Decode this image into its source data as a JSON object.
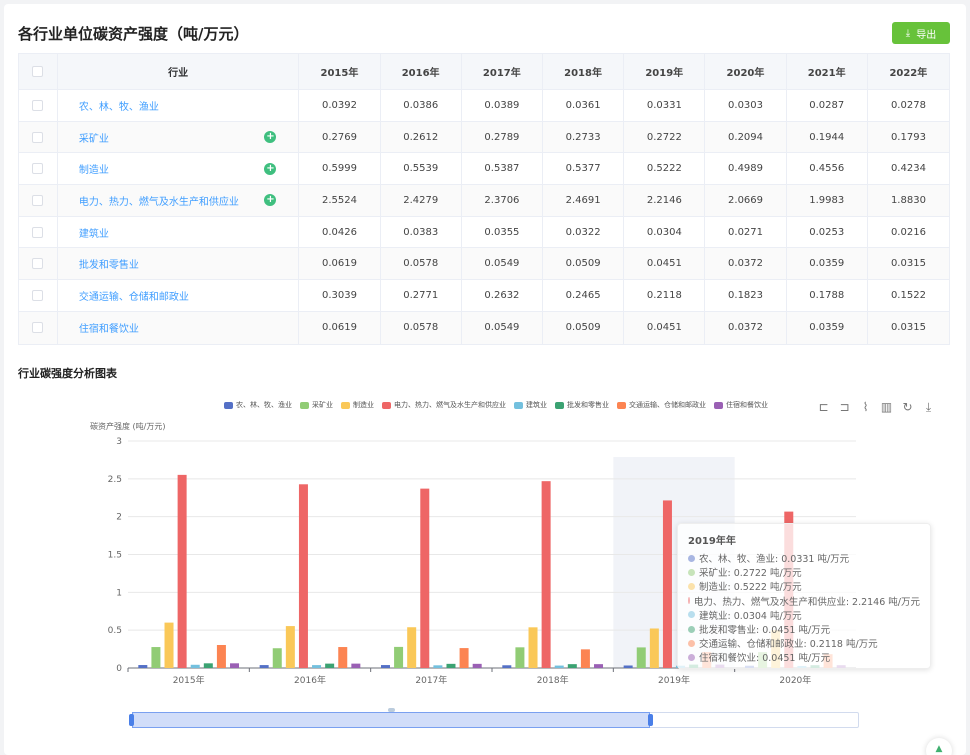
{
  "page": {
    "title": "各行业单位碳资产强度（吨/万元）",
    "export_label": "导出",
    "chart_section_title": "行业碳强度分析图表",
    "scroll_top_icon": "arrow-up-icon"
  },
  "table": {
    "header": {
      "name": "行业",
      "years": [
        "2015年",
        "2016年",
        "2017年",
        "2018年",
        "2019年",
        "2020年",
        "2021年",
        "2022年"
      ]
    },
    "rows": [
      {
        "name": "农、林、牧、渔业",
        "expandable": false,
        "values": [
          "0.0392",
          "0.0386",
          "0.0389",
          "0.0361",
          "0.0331",
          "0.0303",
          "0.0287",
          "0.0278"
        ]
      },
      {
        "name": "采矿业",
        "expandable": true,
        "values": [
          "0.2769",
          "0.2612",
          "0.2789",
          "0.2733",
          "0.2722",
          "0.2094",
          "0.1944",
          "0.1793"
        ]
      },
      {
        "name": "制造业",
        "expandable": true,
        "values": [
          "0.5999",
          "0.5539",
          "0.5387",
          "0.5377",
          "0.5222",
          "0.4989",
          "0.4556",
          "0.4234"
        ]
      },
      {
        "name": "电力、热力、燃气及水生产和供应业",
        "expandable": true,
        "values": [
          "2.5524",
          "2.4279",
          "2.3706",
          "2.4691",
          "2.2146",
          "2.0669",
          "1.9983",
          "1.8830"
        ]
      },
      {
        "name": "建筑业",
        "expandable": false,
        "values": [
          "0.0426",
          "0.0383",
          "0.0355",
          "0.0322",
          "0.0304",
          "0.0271",
          "0.0253",
          "0.0216"
        ]
      },
      {
        "name": "批发和零售业",
        "expandable": false,
        "values": [
          "0.0619",
          "0.0578",
          "0.0549",
          "0.0509",
          "0.0451",
          "0.0372",
          "0.0359",
          "0.0315"
        ]
      },
      {
        "name": "交通运输、仓储和邮政业",
        "expandable": false,
        "values": [
          "0.3039",
          "0.2771",
          "0.2632",
          "0.2465",
          "0.2118",
          "0.1823",
          "0.1788",
          "0.1522"
        ]
      },
      {
        "name": "住宿和餐饮业",
        "expandable": false,
        "values": [
          "0.0619",
          "0.0578",
          "0.0549",
          "0.0509",
          "0.0451",
          "0.0372",
          "0.0359",
          "0.0315"
        ]
      }
    ]
  },
  "toolbox": [
    "crop-zoom-icon",
    "zoom-reset-icon",
    "line-chart-icon",
    "bar-chart-icon",
    "restore-icon",
    "download-icon"
  ],
  "chart_data": {
    "type": "bar",
    "ylabel": "碳资产强度 (吨/万元)",
    "ylim": [
      0,
      3
    ],
    "yticks": [
      "0",
      "0.5",
      "1",
      "1.5",
      "2",
      "2.5",
      "3"
    ],
    "categories": [
      "2015年",
      "2016年",
      "2017年",
      "2018年",
      "2019年",
      "2020年"
    ],
    "grid": true,
    "legend_position": "top",
    "highlighted_category": "2019年",
    "series": [
      {
        "name": "农、林、牧、渔业",
        "color": "#5470c6",
        "values": [
          0.0392,
          0.0386,
          0.0389,
          0.0361,
          0.0331,
          0.0303
        ]
      },
      {
        "name": "采矿业",
        "color": "#91cc75",
        "values": [
          0.2769,
          0.2612,
          0.2789,
          0.2733,
          0.2722,
          0.2094
        ]
      },
      {
        "name": "制造业",
        "color": "#fac858",
        "values": [
          0.5999,
          0.5539,
          0.5387,
          0.5377,
          0.5222,
          0.4989
        ]
      },
      {
        "name": "电力、热力、燃气及水生产和供应业",
        "color": "#ee6666",
        "values": [
          2.5524,
          2.4279,
          2.3706,
          2.4691,
          2.2146,
          2.0669
        ]
      },
      {
        "name": "建筑业",
        "color": "#73c0de",
        "values": [
          0.0426,
          0.0383,
          0.0355,
          0.0322,
          0.0304,
          0.0271
        ]
      },
      {
        "name": "批发和零售业",
        "color": "#3ba272",
        "values": [
          0.0619,
          0.0578,
          0.0549,
          0.0509,
          0.0451,
          0.0372
        ]
      },
      {
        "name": "交通运输、仓储和邮政业",
        "color": "#fc8452",
        "values": [
          0.3039,
          0.2771,
          0.2632,
          0.2465,
          0.2118,
          0.1823
        ]
      },
      {
        "name": "住宿和餐饮业",
        "color": "#9a60b4",
        "values": [
          0.0619,
          0.0578,
          0.0549,
          0.0509,
          0.0451,
          0.0372
        ]
      }
    ],
    "tooltip": {
      "title": "2019年年",
      "rows": [
        "农、林、牧、渔业: 0.0331 吨/万元",
        "采矿业: 0.2722 吨/万元",
        "制造业: 0.5222 吨/万元",
        "电力、热力、燃气及水生产和供应业: 2.2146 吨/万元",
        "建筑业: 0.0304 吨/万元",
        "批发和零售业: 0.0451 吨/万元",
        "交通运输、仓储和邮政业: 0.2118 吨/万元",
        "住宿和餐饮业: 0.0451 吨/万元"
      ]
    },
    "data_zoom": {
      "start_percent": 0,
      "end_percent": 71
    }
  }
}
